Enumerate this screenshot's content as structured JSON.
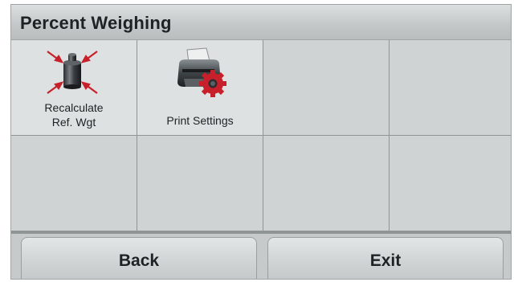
{
  "header": {
    "title": "Percent Weighing"
  },
  "menu": {
    "items": [
      {
        "label_line1": "Recalculate",
        "label_line2": "Ref. Wgt",
        "icon": "weight-recalculate-icon"
      },
      {
        "label": "Print Settings",
        "icon": "printer-settings-icon"
      }
    ]
  },
  "footer": {
    "back_label": "Back",
    "exit_label": "Exit"
  },
  "colors": {
    "arrow": "#c8202a",
    "gear": "#c8202a",
    "tile_active": "#dde1e1",
    "tile": "#cfd3d3"
  }
}
